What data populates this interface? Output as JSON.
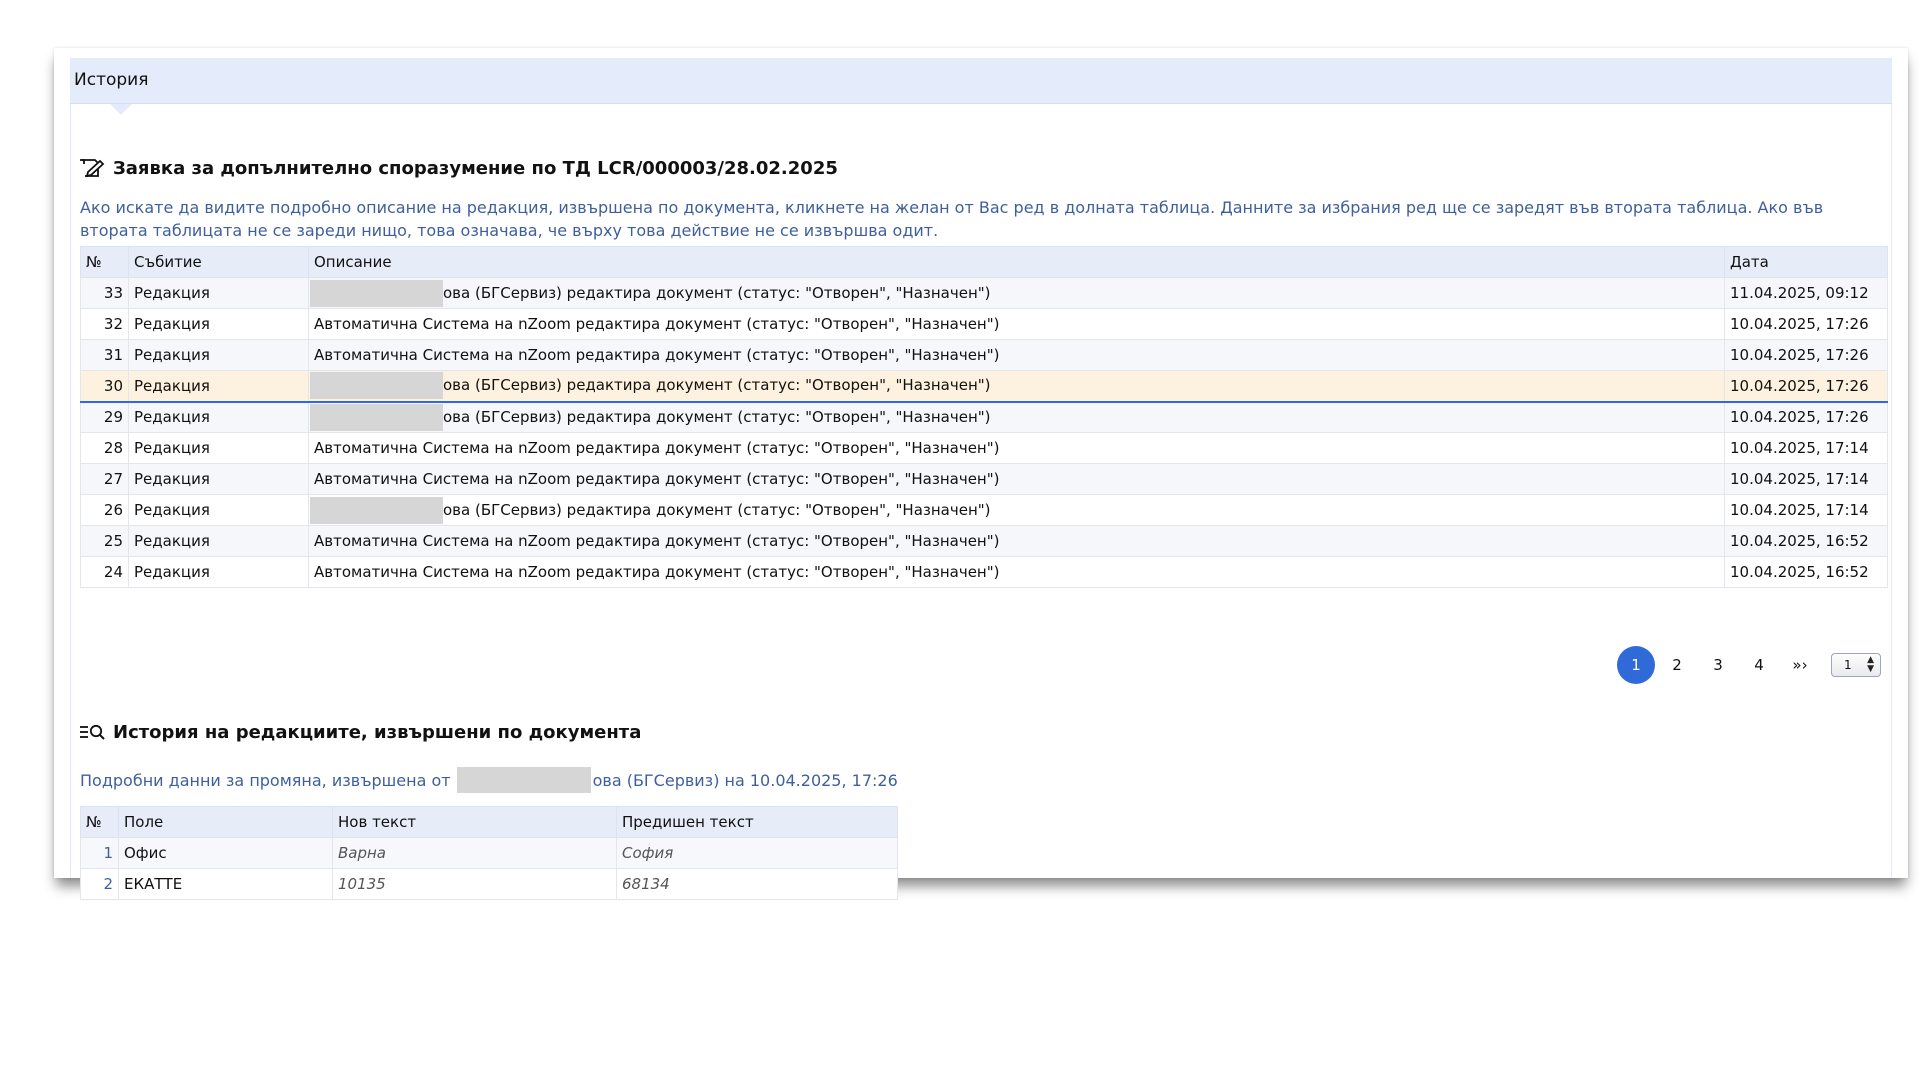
{
  "tab": {
    "label": "История"
  },
  "main": {
    "title": "Заявка за допълнително споразумение по ТД LCR/000003/28.02.2025",
    "info_text": "Ако искате да видите подробно описание на редакция, извършена по документа, кликнете на желан от Вас ред в долната таблица. Данните за избрания ред ще се заредят във втората таблица. Ако във втората таблицата не се зареди нищо, това означава, че върху това действие не се извършва одит."
  },
  "history_table": {
    "headers": {
      "num": "№",
      "event": "Събитие",
      "desc": "Описание",
      "date": "Дата"
    },
    "rows": [
      {
        "num": "33",
        "event": "Редакция",
        "desc": "ова (БГСервиз) редактира документ (статус: \"Отворен\", \"Назначен\")",
        "date": "11.04.2025, 09:12",
        "redacted": true
      },
      {
        "num": "32",
        "event": "Редакция",
        "desc": "Автоматична Система на nZoom редактира документ (статус: \"Отворен\", \"Назначен\")",
        "date": "10.04.2025, 17:26",
        "redacted": false
      },
      {
        "num": "31",
        "event": "Редакция",
        "desc": "Автоматична Система на nZoom редактира документ (статус: \"Отворен\", \"Назначен\")",
        "date": "10.04.2025, 17:26",
        "redacted": false
      },
      {
        "num": "30",
        "event": "Редакция",
        "desc": "ова (БГСервиз) редактира документ (статус: \"Отворен\", \"Назначен\")",
        "date": "10.04.2025, 17:26",
        "redacted": true,
        "selected": true
      },
      {
        "num": "29",
        "event": "Редакция",
        "desc": "ова (БГСервиз) редактира документ (статус: \"Отворен\", \"Назначен\")",
        "date": "10.04.2025, 17:26",
        "redacted": true
      },
      {
        "num": "28",
        "event": "Редакция",
        "desc": "Автоматична Система на nZoom редактира документ (статус: \"Отворен\", \"Назначен\")",
        "date": "10.04.2025, 17:14",
        "redacted": false
      },
      {
        "num": "27",
        "event": "Редакция",
        "desc": "Автоматична Система на nZoom редактира документ (статус: \"Отворен\", \"Назначен\")",
        "date": "10.04.2025, 17:14",
        "redacted": false
      },
      {
        "num": "26",
        "event": "Редакция",
        "desc": "ова (БГСервиз) редактира документ (статус: \"Отворен\", \"Назначен\")",
        "date": "10.04.2025, 17:14",
        "redacted": true
      },
      {
        "num": "25",
        "event": "Редакция",
        "desc": "Автоматична Система на nZoom редактира документ (статус: \"Отворен\", \"Назначен\")",
        "date": "10.04.2025, 16:52",
        "redacted": false
      },
      {
        "num": "24",
        "event": "Редакция",
        "desc": "Автоматична Система на nZoom редактира документ (статус: \"Отворен\", \"Назначен\")",
        "date": "10.04.2025, 16:52",
        "redacted": false
      }
    ]
  },
  "pagination": {
    "pages": [
      "1",
      "2",
      "3",
      "4"
    ],
    "active": "1",
    "next": "»›",
    "select_value": "1"
  },
  "changes": {
    "title": "История на редакциите, извършени по документа",
    "subtitle_prefix": "Подробни данни за промяна, извършена от",
    "subtitle_suffix": "ова (БГСервиз) на 10.04.2025, 17:26",
    "headers": {
      "num": "№",
      "field": "Поле",
      "new": "Нов текст",
      "old": "Предишен текст"
    },
    "rows": [
      {
        "num": "1",
        "field": "Офис",
        "new": "Варна",
        "old": "София"
      },
      {
        "num": "2",
        "field": "ЕКАТТЕ",
        "new": "10135",
        "old": "68134"
      }
    ]
  },
  "colors": {
    "accent": "#2f6ad8",
    "info_text": "#3f5f9c",
    "header_bg": "#e6ecf8",
    "selected_row": "#fcf2df"
  },
  "icons": {
    "title_icon": "document-edit-icon",
    "changes_icon": "list-search-icon"
  }
}
